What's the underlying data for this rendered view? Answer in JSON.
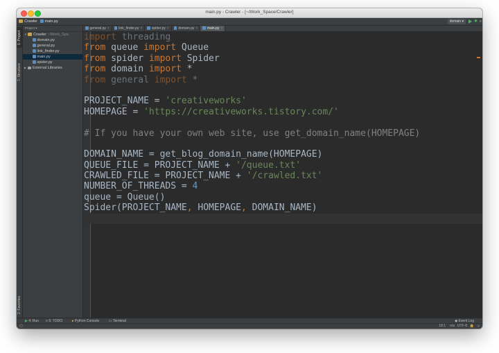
{
  "window": {
    "title": "main.py - Crawler - [~/Work_Space/Crawler]"
  },
  "navbar": {
    "project": "Crawler",
    "file": "main.py",
    "run_config": "domain ▾",
    "run_icon": "run-icon",
    "debug_icon": "debug-icon",
    "search_icon": "search-icon"
  },
  "left_tools": {
    "project": "1: Project",
    "structure": "7: Structure",
    "favorites": "2: Favorites"
  },
  "project_panel": {
    "header": "Project ▾",
    "root": {
      "name": "Crawler",
      "path": "~/Work_Spa"
    },
    "files": [
      "domain.py",
      "general.py",
      "link_finder.py",
      "main.py",
      "spider.py"
    ],
    "selected": "main.py",
    "external": "External Libraries"
  },
  "tabs": [
    {
      "label": "general.py",
      "active": false
    },
    {
      "label": "link_finder.py",
      "active": false
    },
    {
      "label": "spider.py",
      "active": false
    },
    {
      "label": "domain.py",
      "active": false
    },
    {
      "label": "main.py",
      "active": true
    }
  ],
  "code": [
    [
      {
        "t": "import",
        "c": "kw u"
      },
      {
        "t": " threading",
        "c": "u"
      }
    ],
    [
      {
        "t": "from",
        "c": "kw"
      },
      {
        "t": " queue ",
        "c": ""
      },
      {
        "t": "import",
        "c": "kw"
      },
      {
        "t": " Queue",
        "c": ""
      }
    ],
    [
      {
        "t": "from",
        "c": "kw"
      },
      {
        "t": " spider ",
        "c": ""
      },
      {
        "t": "import",
        "c": "kw"
      },
      {
        "t": " Spider",
        "c": ""
      }
    ],
    [
      {
        "t": "from",
        "c": "kw"
      },
      {
        "t": " domain ",
        "c": ""
      },
      {
        "t": "import",
        "c": "kw"
      },
      {
        "t": " *",
        "c": ""
      }
    ],
    [
      {
        "t": "from",
        "c": "kw u"
      },
      {
        "t": " general ",
        "c": "u"
      },
      {
        "t": "import",
        "c": "kw u"
      },
      {
        "t": " *",
        "c": "u"
      }
    ],
    [],
    [
      {
        "t": "PROJECT_NAME = ",
        "c": ""
      },
      {
        "t": "'creativeworks'",
        "c": "str"
      }
    ],
    [
      {
        "t": "HOMEPAGE = ",
        "c": ""
      },
      {
        "t": "'https://creativeworks.tistory.com/'",
        "c": "str"
      }
    ],
    [],
    [
      {
        "t": "# If you have your own web site, use get_domain_name(HOMEPAGE)",
        "c": "cmt"
      }
    ],
    [],
    [
      {
        "t": "DOMAIN_NAME = get_blog_domain_name(HOMEPAGE)",
        "c": ""
      }
    ],
    [
      {
        "t": "QUEUE_FILE = PROJECT_NAME + ",
        "c": ""
      },
      {
        "t": "'/queue.txt'",
        "c": "str"
      }
    ],
    [
      {
        "t": "CRAWLED_FILE = PROJECT_NAME + ",
        "c": ""
      },
      {
        "t": "'/crawled.txt'",
        "c": "str"
      }
    ],
    [
      {
        "t": "NUMBER_OF_THREADS = ",
        "c": ""
      },
      {
        "t": "4",
        "c": "num"
      }
    ],
    [
      {
        "t": "queue = Queue()",
        "c": ""
      }
    ],
    [
      {
        "t": "Spider(PROJECT_NAME",
        "c": ""
      },
      {
        "t": ", ",
        "c": "kw"
      },
      {
        "t": "HOMEPAGE",
        "c": ""
      },
      {
        "t": ", ",
        "c": "kw"
      },
      {
        "t": "DOMAIN_NAME)",
        "c": ""
      }
    ],
    []
  ],
  "caret_line": 18,
  "bottom_tools": {
    "run": "4: Run",
    "todo": "6: TODO",
    "console": "Python Console",
    "terminal": "Terminal",
    "event_log": "Event Log"
  },
  "status": {
    "position": "18:1",
    "separator": "n/a",
    "encoding": "UTF-8"
  },
  "colors": {
    "keyword": "#cc7832",
    "string": "#6a8759",
    "number": "#6897bb",
    "comment": "#808080",
    "text": "#a9b7c6",
    "background": "#2b2b2b"
  }
}
